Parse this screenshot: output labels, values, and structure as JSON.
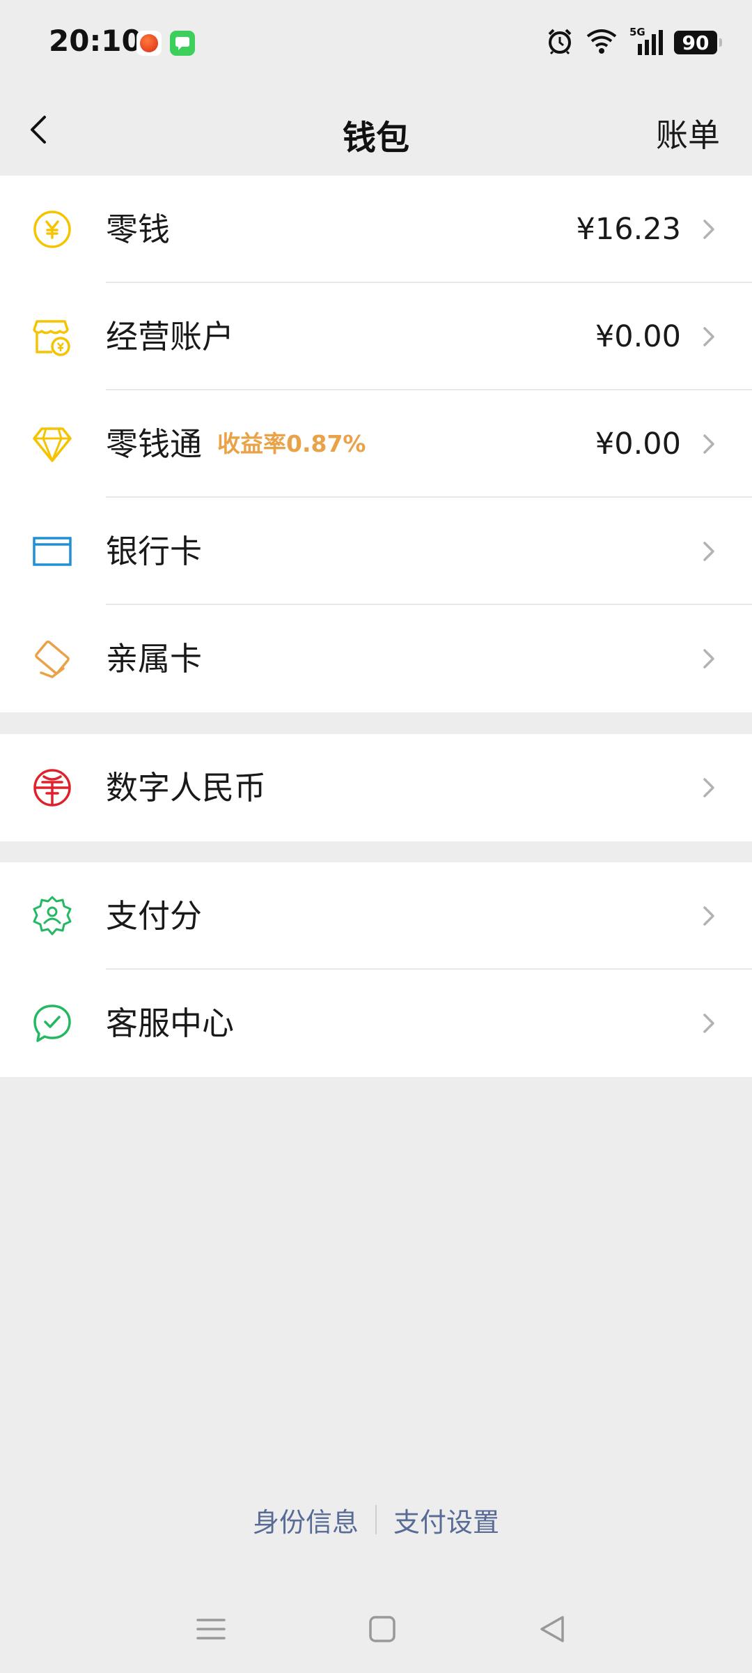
{
  "status_bar": {
    "time": "20:10",
    "network": "5G",
    "battery": "90",
    "icons": [
      "notification-app-icon",
      "messages-app-icon",
      "alarm-icon",
      "wifi-icon",
      "signal-icon",
      "battery-icon"
    ]
  },
  "header": {
    "title": "钱包",
    "bill_label": "账单"
  },
  "group_main": [
    {
      "label": "零钱",
      "amount": "¥16.23",
      "icon": "yuan-coin-icon"
    },
    {
      "label": "经营账户",
      "amount": "¥0.00",
      "icon": "business-account-icon"
    },
    {
      "label": "零钱通",
      "badge": "收益率0.87%",
      "amount": "¥0.00",
      "icon": "diamond-icon"
    },
    {
      "label": "银行卡",
      "icon": "bank-card-icon"
    },
    {
      "label": "亲属卡",
      "icon": "family-card-icon"
    }
  ],
  "group_digital": [
    {
      "label": "数字人民币",
      "icon": "digital-rmb-icon"
    }
  ],
  "group_service": [
    {
      "label": "支付分",
      "icon": "pay-score-icon"
    },
    {
      "label": "客服中心",
      "icon": "customer-service-icon"
    }
  ],
  "footer": {
    "identity_label": "身份信息",
    "settings_label": "支付设置"
  },
  "colors": {
    "background": "#ededed",
    "yellow_icon": "#f5c400",
    "orange_badge": "#e9a247",
    "blue_icon": "#1e90d6",
    "red_icon": "#e0212c",
    "green_icon": "#25b863",
    "link_blue": "#576b95"
  }
}
